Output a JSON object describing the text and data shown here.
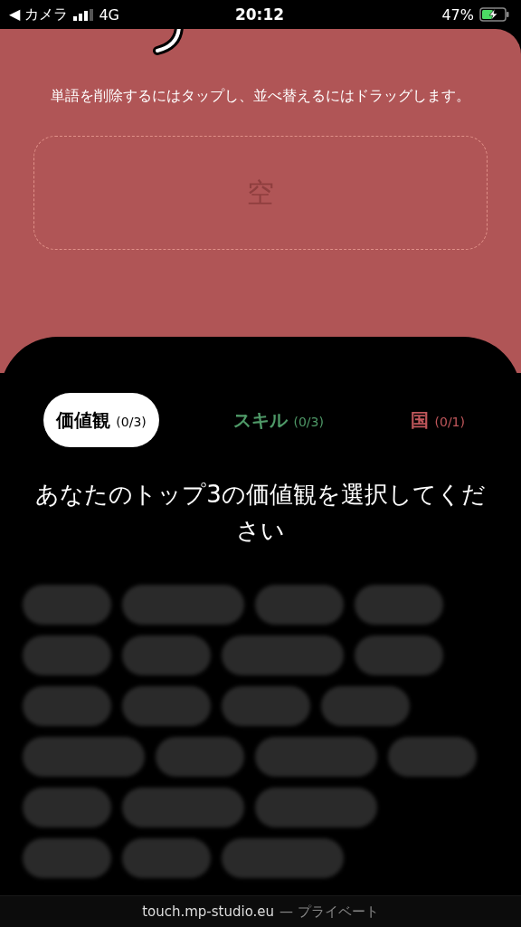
{
  "status_bar": {
    "back": "◀ カメラ",
    "network": "4G",
    "time": "20:12",
    "battery": "47%",
    "charging": true
  },
  "instructions": "単語を削除するにはタップし、並べ替えるにはドラッグします。",
  "drop_zone": {
    "placeholder": "空"
  },
  "tabs": [
    {
      "label": "価値観",
      "count": "(0/3)",
      "selected": true,
      "color": "#000000"
    },
    {
      "label": "スキル",
      "count": "(0/3)",
      "selected": false,
      "color": "#4f9a68"
    },
    {
      "label": "国",
      "count": "(0/1)",
      "selected": false,
      "color": "#c0575b"
    }
  ],
  "prompt": "あなたのトップ3の価値観を選択してください",
  "placeholder_rows": [
    [
      {
        "kind": "short"
      },
      {
        "kind": "long"
      },
      {
        "kind": "short"
      },
      {
        "kind": "short"
      }
    ],
    [
      {
        "kind": "short"
      },
      {
        "kind": "short"
      },
      {
        "kind": "long"
      },
      {
        "kind": "short"
      }
    ],
    [
      {
        "kind": "short"
      },
      {
        "kind": "short"
      },
      {
        "kind": "short"
      },
      {
        "kind": "short"
      }
    ],
    [
      {
        "kind": "long"
      },
      {
        "kind": "short"
      },
      {
        "kind": "long"
      },
      {
        "kind": "short"
      }
    ],
    [
      {
        "kind": "short"
      },
      {
        "kind": "long"
      },
      {
        "kind": "long"
      }
    ],
    [
      {
        "kind": "short"
      },
      {
        "kind": "short"
      },
      {
        "kind": "long"
      }
    ]
  ],
  "footer": {
    "domain": "touch.mp-studio.eu",
    "label": "— プライベート"
  }
}
